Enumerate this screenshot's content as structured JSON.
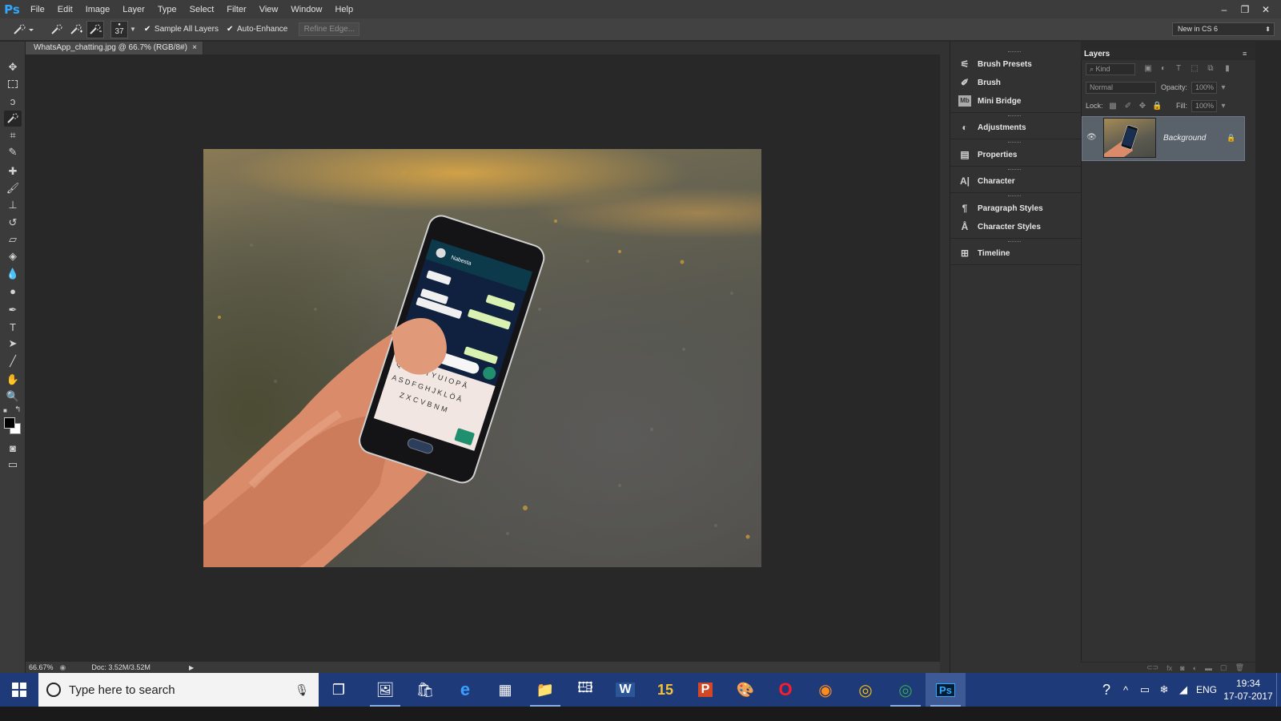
{
  "app": {
    "logo": "Ps",
    "accent": "#31a8ff"
  },
  "menu": [
    "File",
    "Edit",
    "Image",
    "Layer",
    "Type",
    "Select",
    "Filter",
    "View",
    "Window",
    "Help"
  ],
  "window_controls": {
    "minimize": "–",
    "restore": "❐",
    "close": "✕"
  },
  "options": {
    "brush_size": "37",
    "sample_all_layers": "Sample All Layers",
    "auto_enhance": "Auto-Enhance",
    "refine_edge": "Refine Edge...",
    "workspace": "New in CS 6"
  },
  "document": {
    "tab_title": "WhatsApp_chatting.jpg @ 66.7% (RGB/8#)",
    "tab_close": "×",
    "zoom": "66.67%",
    "doc_size": "Doc: 3.52M/3.52M"
  },
  "dock_panels": [
    {
      "label": "Brush Presets",
      "icon": "brush-presets-icon"
    },
    {
      "label": "Brush",
      "icon": "brush-icon"
    },
    {
      "label": "Mini Bridge",
      "icon": "mini-bridge-icon"
    },
    {
      "label": "Adjustments",
      "icon": "adjustments-icon"
    },
    {
      "label": "Properties",
      "icon": "properties-icon"
    },
    {
      "label": "Character",
      "icon": "character-icon"
    },
    {
      "label": "Paragraph Styles",
      "icon": "paragraph-styles-icon"
    },
    {
      "label": "Character Styles",
      "icon": "character-styles-icon"
    },
    {
      "label": "Timeline",
      "icon": "timeline-icon"
    }
  ],
  "layers_panel": {
    "title": "Layers",
    "filter_kind": "Kind",
    "blend_mode": "Normal",
    "opacity_label": "Opacity:",
    "opacity_value": "100%",
    "lock_label": "Lock:",
    "fill_label": "Fill:",
    "fill_value": "100%",
    "layer_name": "Background"
  },
  "taskbar": {
    "search_placeholder": "Type here to search",
    "language": "ENG",
    "time": "19:34",
    "date": "17-07-2017",
    "bg_color": "#1f3a78"
  },
  "phone": {
    "contact": "Nabesta",
    "keyboard_row1": "QWERTYUIOPÅ",
    "keyboard_row2": "ASDFGHJKLÖÄ",
    "keyboard_row3": "ZXCVBNM"
  }
}
